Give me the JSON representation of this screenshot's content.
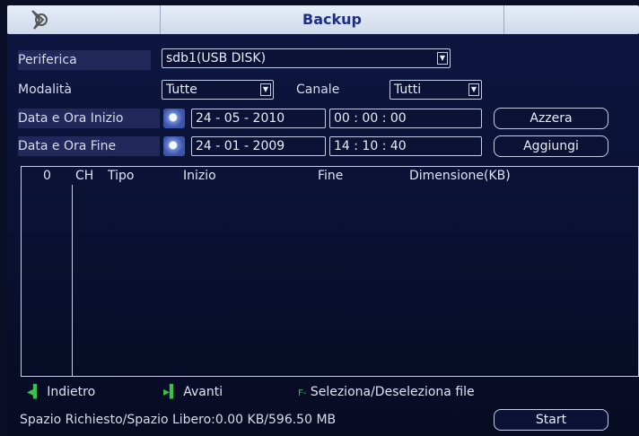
{
  "window": {
    "title": "Backup"
  },
  "form": {
    "periferica": {
      "label": "Periferica",
      "value": "sdb1(USB DISK)"
    },
    "modalita": {
      "label": "Modalità",
      "value": "Tutte"
    },
    "canale": {
      "label": "Canale",
      "value": "Tutti"
    },
    "inizio": {
      "label": "Data e Ora Inizio",
      "date": "24 - 05 - 2010",
      "time": "00 : 00 : 00"
    },
    "fine": {
      "label": "Data e Ora Fine",
      "date": "24 - 01 - 2009",
      "time": "14 : 10 : 40"
    },
    "buttons": {
      "azzera": "Azzera",
      "aggiungi": "Aggiungi"
    }
  },
  "table": {
    "columns": [
      "0",
      "CH",
      "Tipo",
      "Inizio",
      "Fine",
      "Dimensione(KB)"
    ]
  },
  "footer": {
    "prev": "Indietro",
    "next": "Avanti",
    "select": "Seleziona/Deseleziona file",
    "prev_icon": "green-prev-icon",
    "next_icon": "green-next-icon",
    "fn_icon": "fn-key-icon"
  },
  "status": {
    "text": "Spazio Richiesto/Spazio Libero:0.00 KB/596.50 MB"
  },
  "start_button": "Start",
  "colors": {
    "accent_green": "#39c24a",
    "title_blue": "#1c2e8c",
    "panel": "#0a0f25"
  }
}
